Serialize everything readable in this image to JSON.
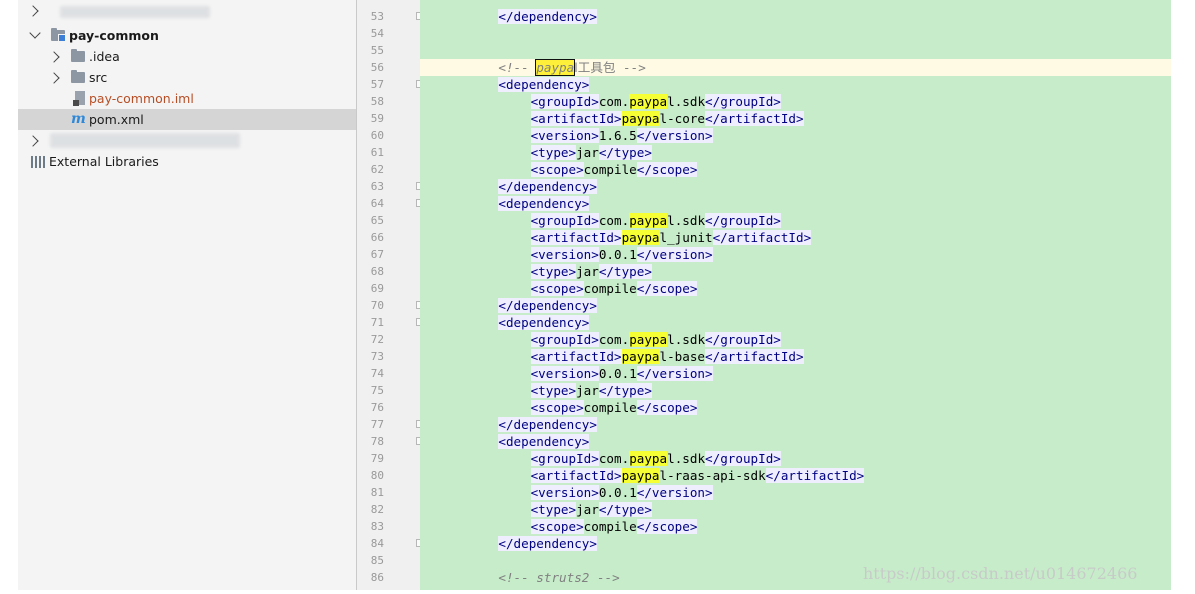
{
  "project_tree": {
    "items": [
      {
        "label": "pay-common",
        "icon": "module-folder-icon",
        "expanded": true,
        "bold": true
      },
      {
        "label": ".idea",
        "icon": "folder-icon",
        "expanded": false
      },
      {
        "label": "src",
        "icon": "folder-icon",
        "expanded": false
      },
      {
        "label": "pay-common.iml",
        "icon": "iml-file-icon",
        "color": "#b64f26"
      },
      {
        "label": "pom.xml",
        "icon": "maven-pom-icon",
        "selected": true
      },
      {
        "label": "External Libraries",
        "icon": "libraries-icon"
      }
    ]
  },
  "editor": {
    "current_line": 56,
    "lines": [
      {
        "n": 53,
        "fold": true,
        "indent": 8,
        "segs": [
          [
            "tag",
            "</dependency>"
          ]
        ]
      },
      {
        "n": 54,
        "segs": []
      },
      {
        "n": 55,
        "segs": []
      },
      {
        "n": 56,
        "indent": 8,
        "segs": [
          [
            "comment",
            "<!-- "
          ],
          [
            "comment-hl",
            "paypa"
          ],
          [
            "cjk",
            "l工具包"
          ],
          [
            "comment",
            " -->"
          ]
        ]
      },
      {
        "n": 57,
        "fold": true,
        "indent": 8,
        "segs": [
          [
            "tag",
            "<dependency>"
          ]
        ]
      },
      {
        "n": 58,
        "indent": 12,
        "segs": [
          [
            "tag",
            "<groupId>"
          ],
          [
            "text",
            "com."
          ],
          [
            "hl",
            "paypa"
          ],
          [
            "text",
            "l.sdk"
          ],
          [
            "tag",
            "</groupId>"
          ]
        ]
      },
      {
        "n": 59,
        "indent": 12,
        "segs": [
          [
            "tag",
            "<artifactId>"
          ],
          [
            "hl",
            "paypa"
          ],
          [
            "text",
            "l-core"
          ],
          [
            "tag",
            "</artifactId>"
          ]
        ]
      },
      {
        "n": 60,
        "indent": 12,
        "segs": [
          [
            "tag",
            "<version>"
          ],
          [
            "text",
            "1.6.5"
          ],
          [
            "tag",
            "</version>"
          ]
        ]
      },
      {
        "n": 61,
        "indent": 12,
        "segs": [
          [
            "tag",
            "<type>"
          ],
          [
            "text",
            "jar"
          ],
          [
            "tag",
            "</type>"
          ]
        ]
      },
      {
        "n": 62,
        "indent": 12,
        "segs": [
          [
            "tag",
            "<scope>"
          ],
          [
            "text",
            "compile"
          ],
          [
            "tag",
            "</scope>"
          ]
        ]
      },
      {
        "n": 63,
        "fold": true,
        "indent": 8,
        "segs": [
          [
            "tag",
            "</dependency>"
          ]
        ]
      },
      {
        "n": 64,
        "fold": true,
        "indent": 8,
        "segs": [
          [
            "tag",
            "<dependency>"
          ]
        ]
      },
      {
        "n": 65,
        "indent": 12,
        "segs": [
          [
            "tag",
            "<groupId>"
          ],
          [
            "text",
            "com."
          ],
          [
            "hl",
            "paypa"
          ],
          [
            "text",
            "l.sdk"
          ],
          [
            "tag",
            "</groupId>"
          ]
        ]
      },
      {
        "n": 66,
        "indent": 12,
        "segs": [
          [
            "tag",
            "<artifactId>"
          ],
          [
            "hl",
            "paypa"
          ],
          [
            "text",
            "l_junit"
          ],
          [
            "tag",
            "</artifactId>"
          ]
        ]
      },
      {
        "n": 67,
        "indent": 12,
        "segs": [
          [
            "tag",
            "<version>"
          ],
          [
            "text",
            "0.0.1"
          ],
          [
            "tag",
            "</version>"
          ]
        ]
      },
      {
        "n": 68,
        "indent": 12,
        "segs": [
          [
            "tag",
            "<type>"
          ],
          [
            "text",
            "jar"
          ],
          [
            "tag",
            "</type>"
          ]
        ]
      },
      {
        "n": 69,
        "indent": 12,
        "segs": [
          [
            "tag",
            "<scope>"
          ],
          [
            "text",
            "compile"
          ],
          [
            "tag",
            "</scope>"
          ]
        ]
      },
      {
        "n": 70,
        "fold": true,
        "indent": 8,
        "segs": [
          [
            "tag",
            "</dependency>"
          ]
        ]
      },
      {
        "n": 71,
        "fold": true,
        "indent": 8,
        "segs": [
          [
            "tag",
            "<dependency>"
          ]
        ]
      },
      {
        "n": 72,
        "indent": 12,
        "segs": [
          [
            "tag",
            "<groupId>"
          ],
          [
            "text",
            "com."
          ],
          [
            "hl",
            "paypa"
          ],
          [
            "text",
            "l.sdk"
          ],
          [
            "tag",
            "</groupId>"
          ]
        ]
      },
      {
        "n": 73,
        "indent": 12,
        "segs": [
          [
            "tag",
            "<artifactId>"
          ],
          [
            "hl",
            "paypa"
          ],
          [
            "text",
            "l-base"
          ],
          [
            "tag",
            "</artifactId>"
          ]
        ]
      },
      {
        "n": 74,
        "indent": 12,
        "segs": [
          [
            "tag",
            "<version>"
          ],
          [
            "text",
            "0.0.1"
          ],
          [
            "tag",
            "</version>"
          ]
        ]
      },
      {
        "n": 75,
        "indent": 12,
        "segs": [
          [
            "tag",
            "<type>"
          ],
          [
            "text",
            "jar"
          ],
          [
            "tag",
            "</type>"
          ]
        ]
      },
      {
        "n": 76,
        "indent": 12,
        "segs": [
          [
            "tag",
            "<scope>"
          ],
          [
            "text",
            "compile"
          ],
          [
            "tag",
            "</scope>"
          ]
        ]
      },
      {
        "n": 77,
        "fold": true,
        "indent": 8,
        "segs": [
          [
            "tag",
            "</dependency>"
          ]
        ]
      },
      {
        "n": 78,
        "fold": true,
        "indent": 8,
        "segs": [
          [
            "tag",
            "<dependency>"
          ]
        ]
      },
      {
        "n": 79,
        "indent": 12,
        "segs": [
          [
            "tag",
            "<groupId>"
          ],
          [
            "text",
            "com."
          ],
          [
            "hl",
            "paypa"
          ],
          [
            "text",
            "l.sdk"
          ],
          [
            "tag",
            "</groupId>"
          ]
        ]
      },
      {
        "n": 80,
        "indent": 12,
        "segs": [
          [
            "tag",
            "<artifactId>"
          ],
          [
            "hl",
            "paypa"
          ],
          [
            "text",
            "l-raas-api-sdk"
          ],
          [
            "tag",
            "</artifactId>"
          ]
        ]
      },
      {
        "n": 81,
        "indent": 12,
        "segs": [
          [
            "tag",
            "<version>"
          ],
          [
            "text",
            "0.0.1"
          ],
          [
            "tag",
            "</version>"
          ]
        ]
      },
      {
        "n": 82,
        "indent": 12,
        "segs": [
          [
            "tag",
            "<type>"
          ],
          [
            "text",
            "jar"
          ],
          [
            "tag",
            "</type>"
          ]
        ]
      },
      {
        "n": 83,
        "indent": 12,
        "segs": [
          [
            "tag",
            "<scope>"
          ],
          [
            "text",
            "compile"
          ],
          [
            "tag",
            "</scope>"
          ]
        ]
      },
      {
        "n": 84,
        "fold": true,
        "indent": 8,
        "segs": [
          [
            "tag",
            "</dependency>"
          ]
        ]
      },
      {
        "n": 85,
        "segs": []
      },
      {
        "n": 86,
        "indent": 8,
        "segs": [
          [
            "comment",
            "<!-- struts2 -->"
          ]
        ]
      }
    ]
  },
  "watermark": "https://blog.csdn.net/u014672466"
}
